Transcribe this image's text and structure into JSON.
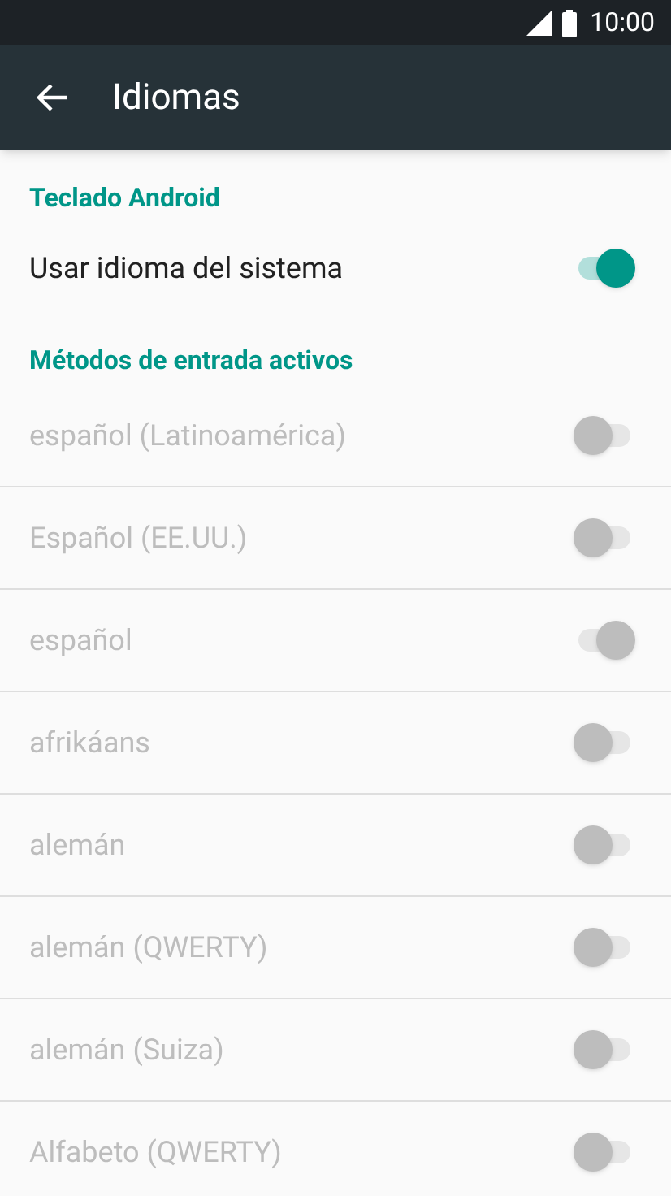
{
  "status_bar": {
    "time": "10:00"
  },
  "toolbar": {
    "title": "Idiomas"
  },
  "sections": [
    {
      "header": "Teclado Android",
      "items": [
        {
          "label": "Usar idioma del sistema",
          "on": true,
          "disabled": false
        }
      ]
    },
    {
      "header": "Métodos de entrada activos",
      "items": [
        {
          "label": "español (Latinoamérica)",
          "on": false,
          "disabled": true
        },
        {
          "label": "Español (EE.UU.)",
          "on": false,
          "disabled": true
        },
        {
          "label": "español",
          "on": true,
          "disabled": true
        },
        {
          "label": "afrikáans",
          "on": false,
          "disabled": true
        },
        {
          "label": "alemán",
          "on": false,
          "disabled": true
        },
        {
          "label": "alemán (QWERTY)",
          "on": false,
          "disabled": true
        },
        {
          "label": "alemán (Suiza)",
          "on": false,
          "disabled": true
        },
        {
          "label": "Alfabeto (QWERTY)",
          "on": false,
          "disabled": true
        }
      ]
    }
  ]
}
